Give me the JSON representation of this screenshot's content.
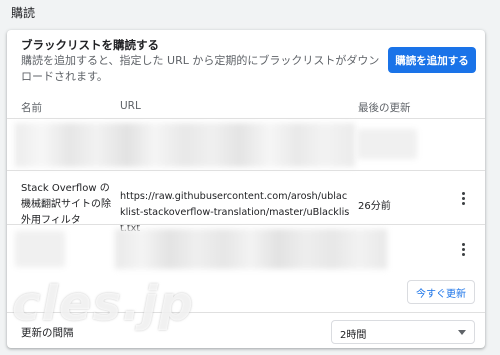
{
  "section": {
    "title": "購読"
  },
  "card": {
    "heading": "ブラックリストを購読する",
    "description": "購読を追加すると、指定した URL から定期的にブラックリストがダウンロードされます。",
    "add_button": "購読を追加する",
    "columns": {
      "name": "名前",
      "url": "URL",
      "updated": "最後の更新"
    },
    "rows": [
      {
        "name": "",
        "url": "",
        "updated": ""
      },
      {
        "name": "Stack Overflow の機械翻訳サイトの除外用フィルタ",
        "url": "https://raw.githubusercontent.com/arosh/ublacklist-stackoverflow-translation/master/uBlacklist.txt",
        "updated": "26分前"
      },
      {
        "name": "",
        "url": "",
        "updated": ""
      }
    ],
    "update_now_button": "今すぐ更新",
    "interval": {
      "label": "更新の間隔",
      "selected": "2時間"
    }
  },
  "watermark": "cles.jp",
  "icons": {
    "row_menu": "more-vert-icon",
    "dropdown": "chevron-down-icon"
  },
  "colors": {
    "accent": "#1a73e8",
    "background": "#f1f3f4"
  }
}
